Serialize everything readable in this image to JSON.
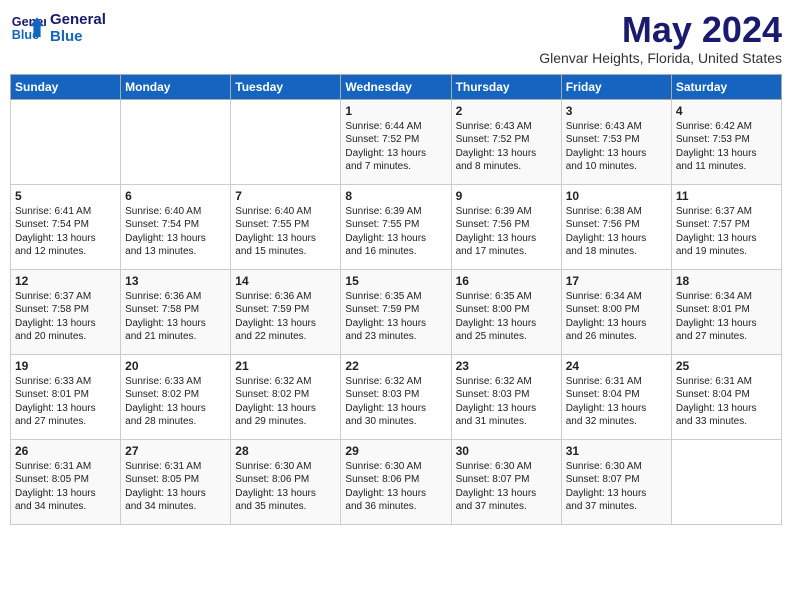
{
  "header": {
    "logo_line1": "General",
    "logo_line2": "Blue",
    "month_title": "May 2024",
    "location": "Glenvar Heights, Florida, United States"
  },
  "days_of_week": [
    "Sunday",
    "Monday",
    "Tuesday",
    "Wednesday",
    "Thursday",
    "Friday",
    "Saturday"
  ],
  "weeks": [
    [
      {
        "day": "",
        "detail": ""
      },
      {
        "day": "",
        "detail": ""
      },
      {
        "day": "",
        "detail": ""
      },
      {
        "day": "1",
        "detail": "Sunrise: 6:44 AM\nSunset: 7:52 PM\nDaylight: 13 hours\nand 7 minutes."
      },
      {
        "day": "2",
        "detail": "Sunrise: 6:43 AM\nSunset: 7:52 PM\nDaylight: 13 hours\nand 8 minutes."
      },
      {
        "day": "3",
        "detail": "Sunrise: 6:43 AM\nSunset: 7:53 PM\nDaylight: 13 hours\nand 10 minutes."
      },
      {
        "day": "4",
        "detail": "Sunrise: 6:42 AM\nSunset: 7:53 PM\nDaylight: 13 hours\nand 11 minutes."
      }
    ],
    [
      {
        "day": "5",
        "detail": "Sunrise: 6:41 AM\nSunset: 7:54 PM\nDaylight: 13 hours\nand 12 minutes."
      },
      {
        "day": "6",
        "detail": "Sunrise: 6:40 AM\nSunset: 7:54 PM\nDaylight: 13 hours\nand 13 minutes."
      },
      {
        "day": "7",
        "detail": "Sunrise: 6:40 AM\nSunset: 7:55 PM\nDaylight: 13 hours\nand 15 minutes."
      },
      {
        "day": "8",
        "detail": "Sunrise: 6:39 AM\nSunset: 7:55 PM\nDaylight: 13 hours\nand 16 minutes."
      },
      {
        "day": "9",
        "detail": "Sunrise: 6:39 AM\nSunset: 7:56 PM\nDaylight: 13 hours\nand 17 minutes."
      },
      {
        "day": "10",
        "detail": "Sunrise: 6:38 AM\nSunset: 7:56 PM\nDaylight: 13 hours\nand 18 minutes."
      },
      {
        "day": "11",
        "detail": "Sunrise: 6:37 AM\nSunset: 7:57 PM\nDaylight: 13 hours\nand 19 minutes."
      }
    ],
    [
      {
        "day": "12",
        "detail": "Sunrise: 6:37 AM\nSunset: 7:58 PM\nDaylight: 13 hours\nand 20 minutes."
      },
      {
        "day": "13",
        "detail": "Sunrise: 6:36 AM\nSunset: 7:58 PM\nDaylight: 13 hours\nand 21 minutes."
      },
      {
        "day": "14",
        "detail": "Sunrise: 6:36 AM\nSunset: 7:59 PM\nDaylight: 13 hours\nand 22 minutes."
      },
      {
        "day": "15",
        "detail": "Sunrise: 6:35 AM\nSunset: 7:59 PM\nDaylight: 13 hours\nand 23 minutes."
      },
      {
        "day": "16",
        "detail": "Sunrise: 6:35 AM\nSunset: 8:00 PM\nDaylight: 13 hours\nand 25 minutes."
      },
      {
        "day": "17",
        "detail": "Sunrise: 6:34 AM\nSunset: 8:00 PM\nDaylight: 13 hours\nand 26 minutes."
      },
      {
        "day": "18",
        "detail": "Sunrise: 6:34 AM\nSunset: 8:01 PM\nDaylight: 13 hours\nand 27 minutes."
      }
    ],
    [
      {
        "day": "19",
        "detail": "Sunrise: 6:33 AM\nSunset: 8:01 PM\nDaylight: 13 hours\nand 27 minutes."
      },
      {
        "day": "20",
        "detail": "Sunrise: 6:33 AM\nSunset: 8:02 PM\nDaylight: 13 hours\nand 28 minutes."
      },
      {
        "day": "21",
        "detail": "Sunrise: 6:32 AM\nSunset: 8:02 PM\nDaylight: 13 hours\nand 29 minutes."
      },
      {
        "day": "22",
        "detail": "Sunrise: 6:32 AM\nSunset: 8:03 PM\nDaylight: 13 hours\nand 30 minutes."
      },
      {
        "day": "23",
        "detail": "Sunrise: 6:32 AM\nSunset: 8:03 PM\nDaylight: 13 hours\nand 31 minutes."
      },
      {
        "day": "24",
        "detail": "Sunrise: 6:31 AM\nSunset: 8:04 PM\nDaylight: 13 hours\nand 32 minutes."
      },
      {
        "day": "25",
        "detail": "Sunrise: 6:31 AM\nSunset: 8:04 PM\nDaylight: 13 hours\nand 33 minutes."
      }
    ],
    [
      {
        "day": "26",
        "detail": "Sunrise: 6:31 AM\nSunset: 8:05 PM\nDaylight: 13 hours\nand 34 minutes."
      },
      {
        "day": "27",
        "detail": "Sunrise: 6:31 AM\nSunset: 8:05 PM\nDaylight: 13 hours\nand 34 minutes."
      },
      {
        "day": "28",
        "detail": "Sunrise: 6:30 AM\nSunset: 8:06 PM\nDaylight: 13 hours\nand 35 minutes."
      },
      {
        "day": "29",
        "detail": "Sunrise: 6:30 AM\nSunset: 8:06 PM\nDaylight: 13 hours\nand 36 minutes."
      },
      {
        "day": "30",
        "detail": "Sunrise: 6:30 AM\nSunset: 8:07 PM\nDaylight: 13 hours\nand 37 minutes."
      },
      {
        "day": "31",
        "detail": "Sunrise: 6:30 AM\nSunset: 8:07 PM\nDaylight: 13 hours\nand 37 minutes."
      },
      {
        "day": "",
        "detail": ""
      }
    ]
  ]
}
